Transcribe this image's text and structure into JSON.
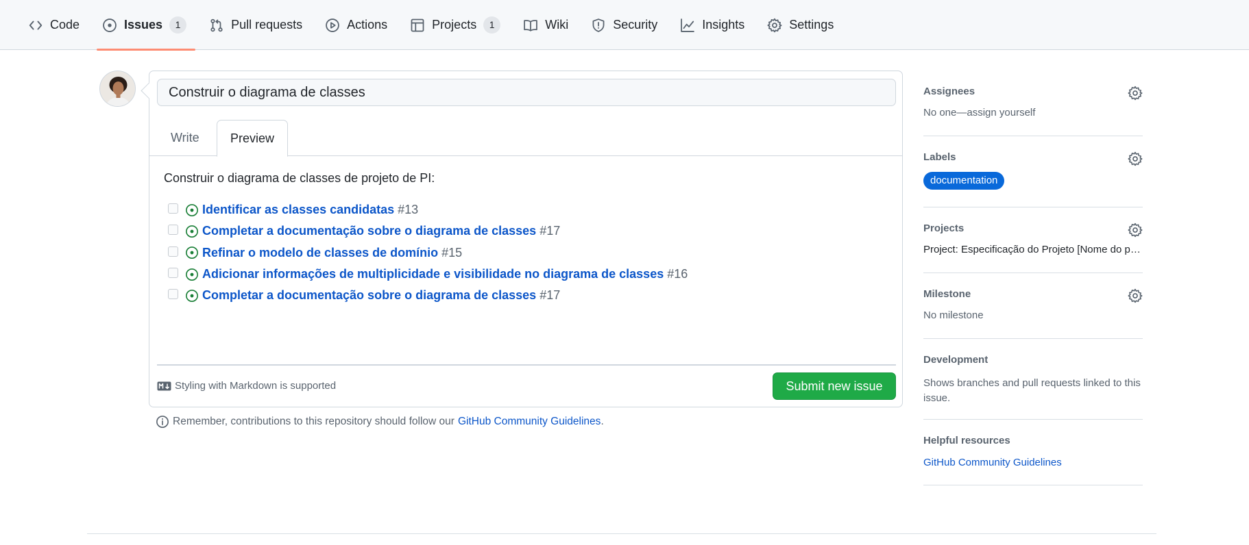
{
  "nav": {
    "items": [
      {
        "label": "Code",
        "icon": "code-icon"
      },
      {
        "label": "Issues",
        "icon": "issue-opened-icon",
        "counter": "1",
        "selected": true
      },
      {
        "label": "Pull requests",
        "icon": "git-pull-request-icon"
      },
      {
        "label": "Actions",
        "icon": "play-icon"
      },
      {
        "label": "Projects",
        "icon": "table-icon",
        "counter": "1"
      },
      {
        "label": "Wiki",
        "icon": "book-icon"
      },
      {
        "label": "Security",
        "icon": "shield-icon"
      },
      {
        "label": "Insights",
        "icon": "graph-icon"
      },
      {
        "label": "Settings",
        "icon": "gear-icon"
      }
    ]
  },
  "issue_form": {
    "title_value": "Construir o diagrama de classes",
    "tabs": {
      "write": "Write",
      "preview": "Preview",
      "active": "Preview"
    },
    "preview": {
      "intro": "Construir o diagrama de classes de projeto de PI:",
      "tasks": [
        {
          "title": "Identificar as classes candidatas",
          "number": "#13",
          "checked": false
        },
        {
          "title": "Completar a documentação sobre o diagrama de classes",
          "number": "#17",
          "checked": false
        },
        {
          "title": "Refinar o modelo de classes de domínio",
          "number": "#15",
          "checked": false
        },
        {
          "title": "Adicionar informações de multiplicidade e visibilidade no diagrama de classes",
          "number": "#16",
          "checked": false
        },
        {
          "title": "Completar a documentação sobre o diagrama de classes",
          "number": "#17",
          "checked": false
        }
      ]
    },
    "markdown_note": "Styling with Markdown is supported",
    "submit_label": "Submit new issue",
    "guidelines_note": "Remember, contributions to this repository should follow our",
    "guidelines_link": "GitHub Community Guidelines",
    "guidelines_end": "."
  },
  "sidebar": {
    "assignees": {
      "heading": "Assignees",
      "value": "No one—assign yourself"
    },
    "labels": {
      "heading": "Labels",
      "items": [
        "documentation"
      ]
    },
    "projects": {
      "heading": "Projects",
      "value": "Project: Especificação do Projeto [Nome do p…"
    },
    "milestone": {
      "heading": "Milestone",
      "value": "No milestone"
    },
    "development": {
      "heading": "Development",
      "value": "Shows branches and pull requests linked to this issue."
    },
    "helpful": {
      "heading": "Helpful resources",
      "link": "GitHub Community Guidelines"
    }
  },
  "colors": {
    "accent_underline": "#fd8c73",
    "link": "#0c56c9",
    "submit_green": "#1faa47",
    "open_issue_green": "#1a7f37",
    "label_blue": "#0969da"
  }
}
